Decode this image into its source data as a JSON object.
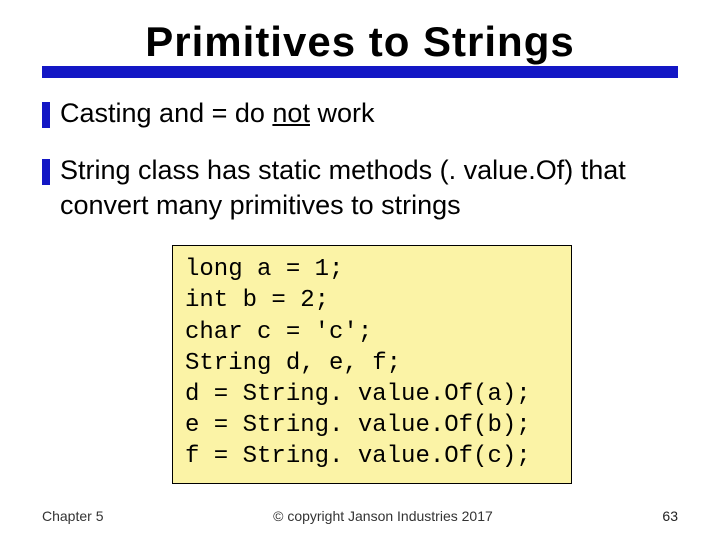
{
  "title": "Primitives to Strings",
  "bullets": [
    {
      "pre": "Casting and = do ",
      "not": "not",
      "post": " work"
    },
    {
      "text": "String class has static methods (. value.Of) that convert many primitives to strings"
    }
  ],
  "code": "long a = 1;\nint b = 2;\nchar c = 'c';\nString d, e, f;\nd = String. value.Of(a);\ne = String. value.Of(b);\nf = String. value.Of(c);",
  "footer": {
    "left": "Chapter 5",
    "center": "© copyright Janson Industries 2017",
    "right": "63"
  }
}
